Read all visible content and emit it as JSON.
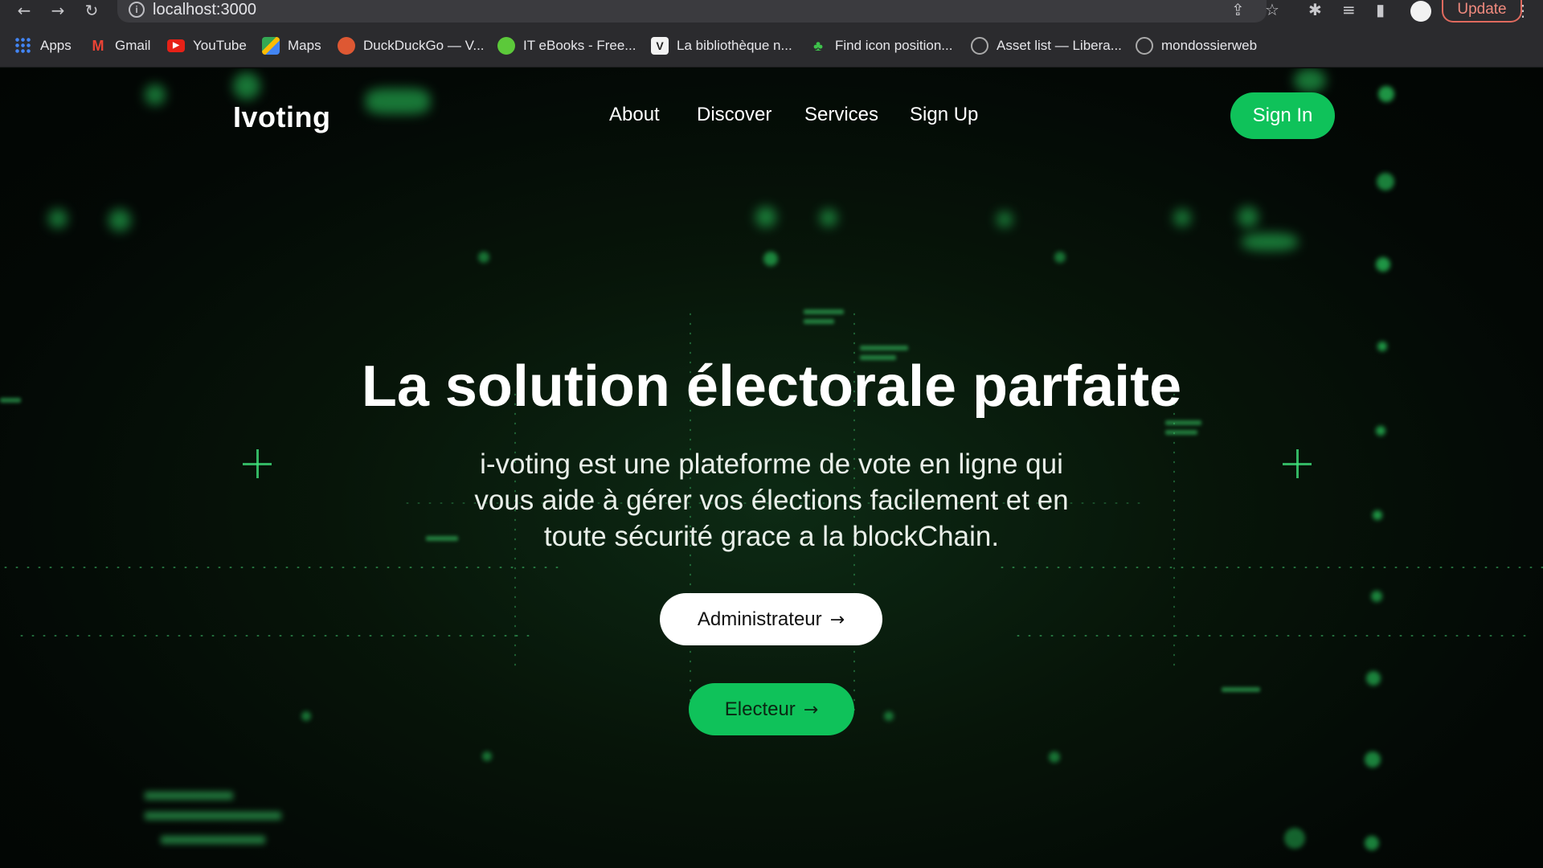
{
  "browser": {
    "url": "localhost:3000",
    "update_label": "Update",
    "bookmarks": [
      {
        "label": "Apps",
        "icon": "apps-grid-icon"
      },
      {
        "label": "Gmail",
        "icon": "gmail-icon"
      },
      {
        "label": "YouTube",
        "icon": "youtube-icon"
      },
      {
        "label": "Maps",
        "icon": "maps-icon"
      },
      {
        "label": "DuckDuckGo — V...",
        "icon": "duckduckgo-icon"
      },
      {
        "label": "IT eBooks - Free...",
        "icon": "green-dot-icon"
      },
      {
        "label": "La bibliothèque n...",
        "icon": "v-logo-icon"
      },
      {
        "label": "Find icon position...",
        "icon": "plant-icon"
      },
      {
        "label": "Asset list — Libera...",
        "icon": "globe-icon"
      },
      {
        "label": "mondossierweb",
        "icon": "globe-icon"
      }
    ]
  },
  "header": {
    "brand": "Ivoting",
    "nav": [
      "About",
      "Discover",
      "Services",
      "Sign Up"
    ],
    "signin_label": "Sign In"
  },
  "hero": {
    "title": "La solution électorale parfaite",
    "subtitle": "i-voting est une plateforme de vote en ligne qui vous aide à gérer vos élections facilement et en toute sécurité grace a la blockChain.",
    "admin_label": "Administrateur",
    "voter_label": "Electeur"
  },
  "colors": {
    "accent": "#0fc25a",
    "background": "#030805"
  }
}
